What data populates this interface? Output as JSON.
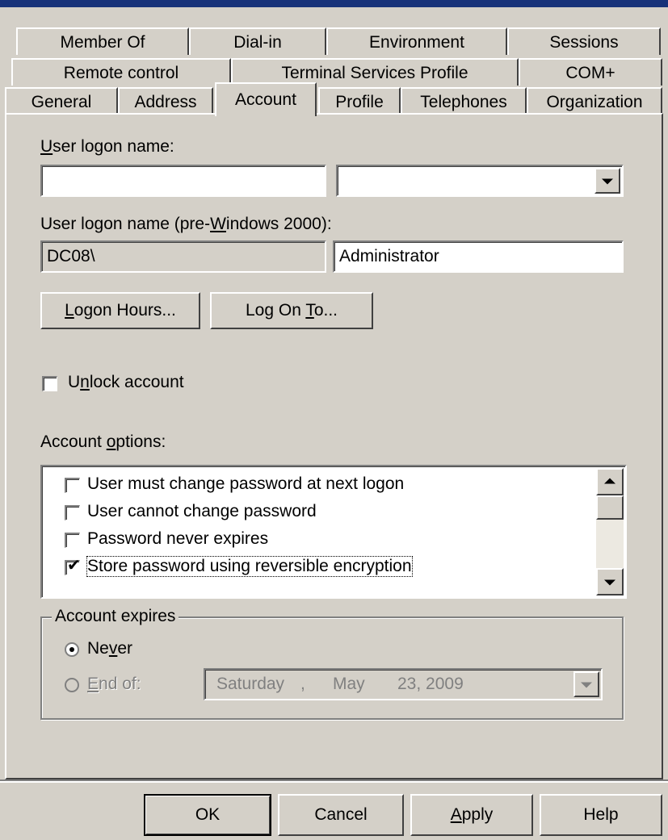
{
  "tabs": {
    "row1": [
      "Member Of",
      "Dial-in",
      "Environment",
      "Sessions"
    ],
    "row2": [
      "Remote control",
      "Terminal Services Profile",
      "COM+"
    ],
    "row3": [
      "General",
      "Address",
      "Account",
      "Profile",
      "Telephones",
      "Organization"
    ],
    "active": "Account"
  },
  "logon": {
    "label_u": "U",
    "label_rest": "ser logon name:",
    "value": "",
    "domain_value": ""
  },
  "prewin": {
    "label_before": "User logon name (pre-",
    "label_u": "W",
    "label_after": "indows 2000):",
    "domain": "DC08\\",
    "username": "Administrator"
  },
  "buttons": {
    "logon_hours_u": "L",
    "logon_hours_rest": "ogon Hours...",
    "logon_to_before": "Log On ",
    "logon_to_u": "T",
    "logon_to_after": "o..."
  },
  "unlock": {
    "before": "U",
    "u": "n",
    "after": "lock account",
    "checked": false
  },
  "options": {
    "label_before": "Account ",
    "label_u": "o",
    "label_after": "ptions:",
    "items": [
      {
        "label": "User must change password at next logon",
        "checked": false
      },
      {
        "label": "User cannot change password",
        "checked": false
      },
      {
        "label": "Password never expires",
        "checked": false
      },
      {
        "label": "Store password using reversible encryption",
        "checked": true
      }
    ]
  },
  "expires": {
    "title": "Account expires",
    "never_before": "Ne",
    "never_u": "v",
    "never_after": "er",
    "endof_u": "E",
    "endof_after": "nd of:",
    "selected": "never",
    "date_day": "Saturday",
    "date_sep": ",",
    "date_month": "May",
    "date_rest": "23, 2009"
  },
  "footer": {
    "ok": "OK",
    "cancel": "Cancel",
    "apply_u": "A",
    "apply_rest": "pply",
    "help": "Help"
  }
}
